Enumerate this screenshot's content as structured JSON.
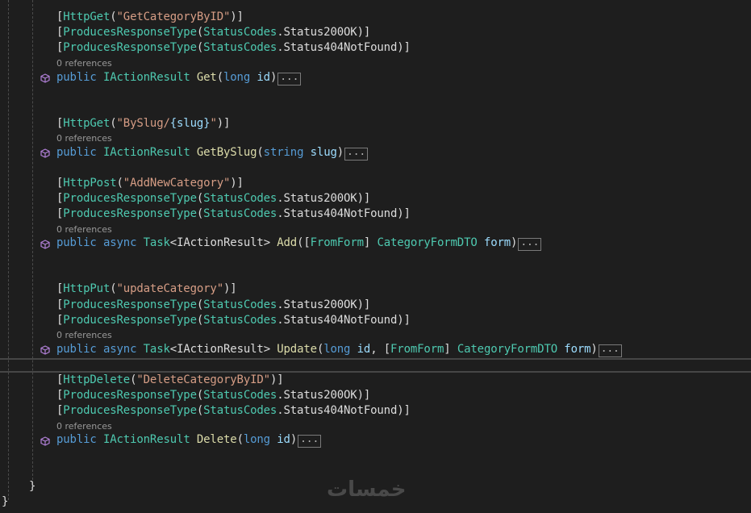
{
  "codelens": {
    "references_label": "0 references"
  },
  "collapsed_marker": "...",
  "block1": {
    "attr_http": "HttpGet",
    "attr_route": "\"GetCategoryByID\"",
    "produces": "ProducesResponseType",
    "status_codes": "StatusCodes",
    "status_200": "Status200OK",
    "status_404": "Status404NotFound",
    "kw_public": "public",
    "return_type": "IActionResult",
    "method": "Get",
    "param_type": "long",
    "param_name": "id"
  },
  "block2": {
    "attr_http": "HttpGet",
    "route_prefix": "\"BySlug/",
    "route_param": "{slug}",
    "route_suffix": "\"",
    "kw_public": "public",
    "return_type": "IActionResult",
    "method": "GetBySlug",
    "param_type": "string",
    "param_name": "slug"
  },
  "block3": {
    "attr_http": "HttpPost",
    "attr_route": "\"AddNewCategory\"",
    "produces": "ProducesResponseType",
    "status_codes": "StatusCodes",
    "status_200": "Status200OK",
    "status_404": "Status404NotFound",
    "kw_public": "public",
    "kw_async": "async",
    "task": "Task",
    "return_type": "IActionResult",
    "method": "Add",
    "from_form": "FromForm",
    "param_type": "CategoryFormDTO",
    "param_name": "form"
  },
  "block4": {
    "attr_http": "HttpPut",
    "attr_route": "\"updateCategory\"",
    "produces": "ProducesResponseType",
    "status_codes": "StatusCodes",
    "status_200": "Status200OK",
    "status_404": "Status404NotFound",
    "kw_public": "public",
    "kw_async": "async",
    "task": "Task",
    "return_type": "IActionResult",
    "method": "Update",
    "param1_type": "long",
    "param1_name": "id",
    "from_form": "FromForm",
    "param2_type": "CategoryFormDTO",
    "param2_name": "form"
  },
  "block5": {
    "attr_http": "HttpDelete",
    "attr_route": "\"DeleteCategoryByID\"",
    "produces": "ProducesResponseType",
    "status_codes": "StatusCodes",
    "status_200": "Status200OK",
    "status_404": "Status404NotFound",
    "kw_public": "public",
    "return_type": "IActionResult",
    "method": "Delete",
    "param_type": "long",
    "param_name": "id"
  },
  "closing_brace": "}",
  "watermark_text": "خمسات",
  "icons": {
    "method_glyph": "method-cube-icon"
  }
}
